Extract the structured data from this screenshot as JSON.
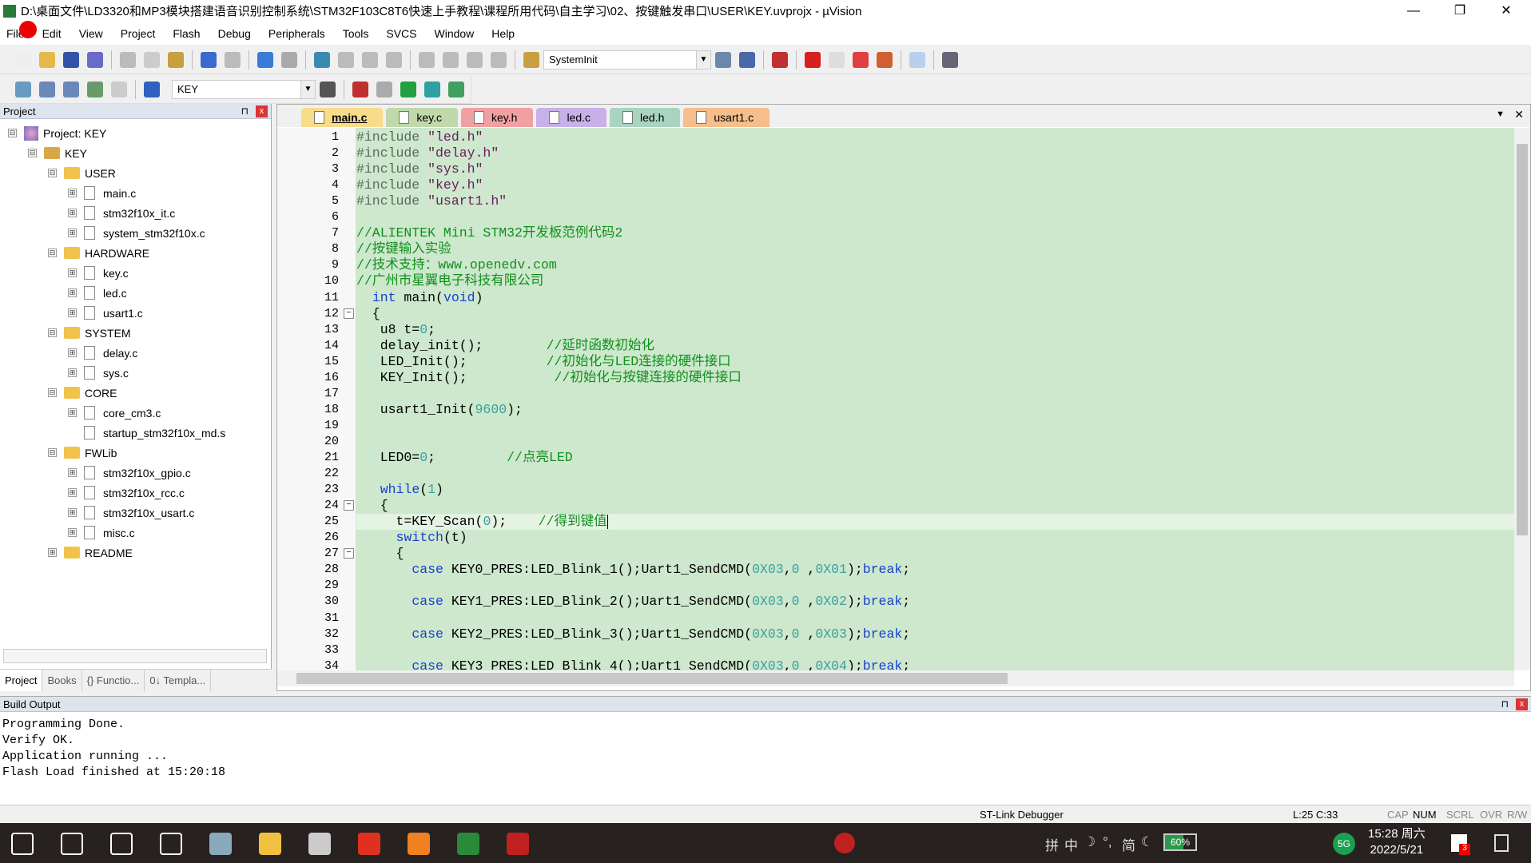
{
  "window": {
    "title": "D:\\桌面文件\\LD3320和MP3模块搭建语音识别控制系统\\STM32F103C8T6快速上手教程\\课程所用代码\\自主学习\\02、按键触发串口\\USER\\KEY.uvprojx - µVision",
    "min": "—",
    "max": "❐",
    "close": "✕"
  },
  "menu": [
    "File",
    "Edit",
    "View",
    "Project",
    "Flash",
    "Debug",
    "Peripherals",
    "Tools",
    "SVCS",
    "Window",
    "Help"
  ],
  "toolbar1": {
    "icons": [
      [
        "new-file-icon",
        "#eee"
      ],
      [
        "open-icon",
        "#e6b84a"
      ],
      [
        "save-icon",
        "#3353a8"
      ],
      [
        "save-all-icon",
        "#6a6ac8"
      ],
      [
        "sep"
      ],
      [
        "cut-icon",
        "#bbb"
      ],
      [
        "copy-icon",
        "#ccc"
      ],
      [
        "paste-icon",
        "#c9a040"
      ],
      [
        "sep"
      ],
      [
        "undo-icon",
        "#3a6ad0"
      ],
      [
        "redo-icon",
        "#bbb"
      ],
      [
        "sep"
      ],
      [
        "nav-back-icon",
        "#3a7ad8"
      ],
      [
        "nav-forward-icon",
        "#aaa"
      ],
      [
        "sep"
      ],
      [
        "bookmark-icon",
        "#3a8ab0"
      ],
      [
        "prev-bookmark-icon",
        "#bbb"
      ],
      [
        "next-bookmark-icon",
        "#bbb"
      ],
      [
        "clear-bookmarks-icon",
        "#bbb"
      ],
      [
        "sep"
      ],
      [
        "indent-icon",
        "#bbb"
      ],
      [
        "unindent-icon",
        "#bbb"
      ],
      [
        "comment-icon",
        "#bbb"
      ],
      [
        "uncomment-icon",
        "#bbb"
      ],
      [
        "sep"
      ],
      [
        "find-in-files-icon",
        "#c9a040"
      ]
    ],
    "find_value": "SystemInit",
    "icons2": [
      [
        "find-icon",
        "#6a88aa"
      ],
      [
        "incremental-find-icon",
        "#4a68a8"
      ],
      [
        "sep"
      ],
      [
        "debug-start-icon",
        "#c03030"
      ],
      [
        "sep"
      ],
      [
        "breakpoint-icon",
        "#d42020"
      ],
      [
        "breakpoint-disable-icon",
        "#ddd"
      ],
      [
        "breakpoint-kill-icon",
        "#e04040"
      ],
      [
        "breakpoint-kill-all-icon",
        "#d06030"
      ],
      [
        "sep"
      ],
      [
        "window-layout-icon",
        "#b8d0f0"
      ],
      [
        "sep"
      ],
      [
        "configure-icon",
        "#667"
      ]
    ]
  },
  "toolbar2": {
    "icons": [
      [
        "translate-icon",
        "#6a9ac0"
      ],
      [
        "build-icon",
        "#6a88b8"
      ],
      [
        "rebuild-icon",
        "#6a88b8"
      ],
      [
        "batch-build-icon",
        "#6a9a6a"
      ],
      [
        "stop-build-icon",
        "#ccc"
      ],
      [
        "sep"
      ],
      [
        "download-icon",
        "#3060c0"
      ]
    ],
    "target": "KEY",
    "icons2": [
      [
        "target-options-icon",
        "#555"
      ],
      [
        "sep"
      ],
      [
        "manage-project-icon",
        "#c03030"
      ],
      [
        "manage-books-icon",
        "#aaa"
      ],
      [
        "select-packs-icon",
        "#20a040"
      ],
      [
        "manage-rte-icon",
        "#30a0a0"
      ],
      [
        "pack-installer-icon",
        "#40a060"
      ]
    ]
  },
  "project_panel": {
    "title": "Project",
    "pin": "⊓",
    "close": "x",
    "tree": [
      [
        0,
        "project",
        "Project: KEY",
        "⊟"
      ],
      [
        1,
        "target",
        "KEY",
        "⊟"
      ],
      [
        2,
        "folder",
        "USER",
        "⊟"
      ],
      [
        3,
        "file",
        "main.c",
        "⊞"
      ],
      [
        3,
        "file",
        "stm32f10x_it.c",
        "⊞"
      ],
      [
        3,
        "file",
        "system_stm32f10x.c",
        "⊞"
      ],
      [
        2,
        "folder",
        "HARDWARE",
        "⊟"
      ],
      [
        3,
        "file",
        "key.c",
        "⊞"
      ],
      [
        3,
        "file",
        "led.c",
        "⊞"
      ],
      [
        3,
        "file",
        "usart1.c",
        "⊞"
      ],
      [
        2,
        "folder",
        "SYSTEM",
        "⊟"
      ],
      [
        3,
        "file",
        "delay.c",
        "⊞"
      ],
      [
        3,
        "file",
        "sys.c",
        "⊞"
      ],
      [
        2,
        "folder",
        "CORE",
        "⊟"
      ],
      [
        3,
        "file",
        "core_cm3.c",
        "⊞"
      ],
      [
        3,
        "file",
        "startup_stm32f10x_md.s",
        ""
      ],
      [
        2,
        "folder",
        "FWLib",
        "⊟"
      ],
      [
        3,
        "file",
        "stm32f10x_gpio.c",
        "⊞"
      ],
      [
        3,
        "file",
        "stm32f10x_rcc.c",
        "⊞"
      ],
      [
        3,
        "file",
        "stm32f10x_usart.c",
        "⊞"
      ],
      [
        3,
        "file",
        "misc.c",
        "⊞"
      ],
      [
        2,
        "folder",
        "README",
        "⊞"
      ]
    ],
    "tabs": [
      "Project",
      "Books",
      "{} Functio...",
      "0↓ Templa..."
    ]
  },
  "editor": {
    "tabs": [
      [
        "main.c",
        "#f7dc8a"
      ],
      [
        "key.c",
        "#bfd9a8"
      ],
      [
        "key.h",
        "#f0a0a0"
      ],
      [
        "led.c",
        "#c8b0e8"
      ],
      [
        "led.h",
        "#a8d4c0"
      ],
      [
        "usart1.c",
        "#f5be8a"
      ]
    ],
    "active_tab": 0,
    "current_line": 25,
    "cursor": "L:25 C:33",
    "lines": [
      [
        [
          "pp",
          "#include "
        ],
        [
          "str",
          "\"led.h\""
        ]
      ],
      [
        [
          "pp",
          "#include "
        ],
        [
          "str",
          "\"delay.h\""
        ]
      ],
      [
        [
          "pp",
          "#include "
        ],
        [
          "str",
          "\"sys.h\""
        ]
      ],
      [
        [
          "pp",
          "#include "
        ],
        [
          "str",
          "\"key.h\""
        ]
      ],
      [
        [
          "pp",
          "#include "
        ],
        [
          "str",
          "\"usart1.h\""
        ]
      ],
      [],
      [
        [
          "cm",
          "//ALIENTEK Mini STM32开发板范例代码2"
        ]
      ],
      [
        [
          "cm",
          "//按键输入实验"
        ]
      ],
      [
        [
          "cm",
          "//技术支持：www.openedv.com"
        ]
      ],
      [
        [
          "cm",
          "//广州市星翼电子科技有限公司"
        ]
      ],
      [
        [
          "",
          "  "
        ],
        [
          "kw",
          "int"
        ],
        [
          "",
          " main("
        ],
        [
          "kw",
          "void"
        ],
        [
          "",
          ")"
        ]
      ],
      [
        [
          "",
          "  {"
        ]
      ],
      [
        [
          "",
          "   u8 t="
        ],
        [
          "num",
          "0"
        ],
        [
          "",
          ";"
        ]
      ],
      [
        [
          "",
          "   delay_init();        "
        ],
        [
          "cm",
          "//延时函数初始化"
        ]
      ],
      [
        [
          "",
          "   LED_Init();          "
        ],
        [
          "cm",
          "//初始化与LED连接的硬件接口"
        ]
      ],
      [
        [
          "",
          "   KEY_Init();           "
        ],
        [
          "cm",
          "//初始化与按键连接的硬件接口"
        ]
      ],
      [],
      [
        [
          "",
          "   usart1_Init("
        ],
        [
          "num",
          "9600"
        ],
        [
          "",
          ");"
        ]
      ],
      [],
      [],
      [
        [
          "",
          "   LED0="
        ],
        [
          "num",
          "0"
        ],
        [
          "",
          ";         "
        ],
        [
          "cm",
          "//点亮LED"
        ]
      ],
      [],
      [
        [
          "",
          "   "
        ],
        [
          "kw",
          "while"
        ],
        [
          "",
          "("
        ],
        [
          "num",
          "1"
        ],
        [
          "",
          ")"
        ]
      ],
      [
        [
          "",
          "   {"
        ]
      ],
      [
        [
          "",
          "     t=KEY_Scan("
        ],
        [
          "num",
          "0"
        ],
        [
          "",
          ");    "
        ],
        [
          "cm",
          "//得到键值"
        ]
      ],
      [
        [
          "",
          "     "
        ],
        [
          "kw",
          "switch"
        ],
        [
          "",
          "(t)"
        ]
      ],
      [
        [
          "",
          "     {"
        ]
      ],
      [
        [
          "",
          "       "
        ],
        [
          "kw",
          "case"
        ],
        [
          "",
          " KEY0_PRES:LED_Blink_1();Uart1_SendCMD("
        ],
        [
          "num",
          "0X03"
        ],
        [
          "",
          ","
        ],
        [
          "num",
          "0"
        ],
        [
          "",
          " ,"
        ],
        [
          "num",
          "0X01"
        ],
        [
          "",
          ");"
        ],
        [
          "kw",
          "break"
        ],
        [
          "",
          ";"
        ]
      ],
      [],
      [
        [
          "",
          "       "
        ],
        [
          "kw",
          "case"
        ],
        [
          "",
          " KEY1_PRES:LED_Blink_2();Uart1_SendCMD("
        ],
        [
          "num",
          "0X03"
        ],
        [
          "",
          ","
        ],
        [
          "num",
          "0"
        ],
        [
          "",
          " ,"
        ],
        [
          "num",
          "0X02"
        ],
        [
          "",
          ");"
        ],
        [
          "kw",
          "break"
        ],
        [
          "",
          ";"
        ]
      ],
      [],
      [
        [
          "",
          "       "
        ],
        [
          "kw",
          "case"
        ],
        [
          "",
          " KEY2_PRES:LED_Blink_3();Uart1_SendCMD("
        ],
        [
          "num",
          "0X03"
        ],
        [
          "",
          ","
        ],
        [
          "num",
          "0"
        ],
        [
          "",
          " ,"
        ],
        [
          "num",
          "0X03"
        ],
        [
          "",
          ");"
        ],
        [
          "kw",
          "break"
        ],
        [
          "",
          ";"
        ]
      ],
      [],
      [
        [
          "",
          "       "
        ],
        [
          "kw",
          "case"
        ],
        [
          "",
          " KEY3_PRES:LED_Blink_4();Uart1_SendCMD("
        ],
        [
          "num",
          "0X03"
        ],
        [
          "",
          ","
        ],
        [
          "num",
          "0"
        ],
        [
          "",
          " ,"
        ],
        [
          "num",
          "0X04"
        ],
        [
          "",
          ");"
        ],
        [
          "kw",
          "break"
        ],
        [
          "",
          ";"
        ]
      ]
    ],
    "fold_lines": [
      12,
      24,
      27
    ]
  },
  "build_output": {
    "title": "Build Output",
    "text": "Programming Done.\nVerify OK.\nApplication running ...\nFlash Load finished at 15:20:18"
  },
  "status": {
    "debugger": "ST-Link Debugger",
    "cursor": "L:25 C:33",
    "cap": "CAP",
    "num": "NUM",
    "scrl": "SCRL",
    "ovr": "OVR",
    "rw": "R/W"
  },
  "taskbar": {
    "apps": [
      [
        "start-icon",
        "#fff"
      ],
      [
        "search-icon",
        "#fff"
      ],
      [
        "cortana-icon",
        "#fff"
      ],
      [
        "task-view-icon",
        "#fff"
      ],
      [
        "app-icon",
        "#8ab"
      ],
      [
        "file-explorer-icon",
        "#f0c040"
      ],
      [
        "app-icon",
        "#ccc"
      ],
      [
        "wps-icon",
        "#e03020"
      ],
      [
        "app-icon",
        "#f08020"
      ],
      [
        "keil-icon",
        "#2a8a3a"
      ],
      [
        "stc-icon",
        "#c02020"
      ]
    ],
    "tray": [
      "拼",
      "中",
      "☽",
      "°,",
      "简",
      "☾"
    ],
    "battery": "60%",
    "network": "5G",
    "time": "15:28 周六",
    "date": "2022/5/21",
    "notif_count": "3"
  }
}
